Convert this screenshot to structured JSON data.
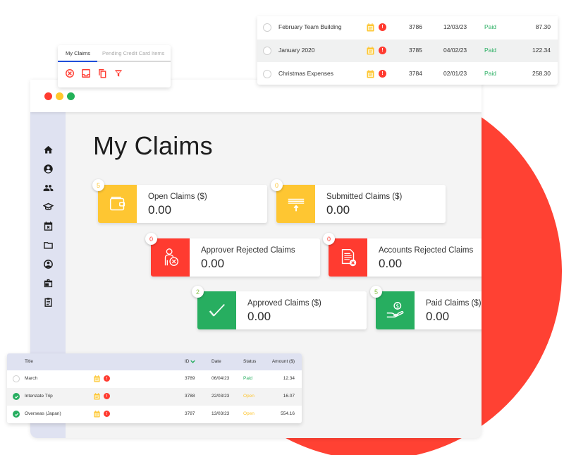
{
  "colors": {
    "accent_red": "#ff4133",
    "yellow": "#fec632",
    "green": "#27ae60",
    "tab_active": "#1f4fd9",
    "sidebar_bg": "#dfe2f1"
  },
  "window": {
    "title": "My Claims",
    "traffic_lights": [
      "close",
      "minimize",
      "maximize"
    ]
  },
  "sidebar": {
    "items": [
      {
        "icon": "home-icon"
      },
      {
        "icon": "account-icon"
      },
      {
        "icon": "people-icon"
      },
      {
        "icon": "graduation-cap-icon"
      },
      {
        "icon": "calendar-cancel-icon"
      },
      {
        "icon": "folder-icon"
      },
      {
        "icon": "support-icon"
      },
      {
        "icon": "briefcase-icon"
      },
      {
        "icon": "clipboard-icon"
      }
    ]
  },
  "tabs_panel": {
    "tabs": [
      {
        "label": "My Claims",
        "active": true
      },
      {
        "label": "Pending Credit Card Items",
        "active": false
      }
    ],
    "toolbar": [
      "cancel-icon",
      "inbox-icon",
      "copy-icon",
      "filter-icon"
    ]
  },
  "cards": [
    {
      "label": "Open Claims ($)",
      "value": "0.00",
      "count": "5",
      "color": "yellow",
      "icon": "wallet-icon"
    },
    {
      "label": "Submitted Claims ($)",
      "value": "0.00",
      "count": "0",
      "color": "yellow",
      "icon": "submit-icon"
    },
    {
      "label": "Approver Rejected Claims",
      "value": "0.00",
      "count": "0",
      "color": "red",
      "icon": "user-rejected-icon"
    },
    {
      "label": "Accounts Rejected Claims",
      "value": "0.00",
      "count": "0",
      "color": "red",
      "icon": "document-rejected-icon"
    },
    {
      "label": "Approved Claims ($)",
      "value": "0.00",
      "count": "2",
      "color": "green",
      "icon": "checkmark-icon"
    },
    {
      "label": "Paid Claims ($)",
      "value": "0.00",
      "count": "5",
      "color": "green",
      "icon": "hand-money-icon"
    }
  ],
  "top_table": {
    "rows": [
      {
        "title": "February Team Building",
        "id": "3786",
        "date": "12/03/23",
        "status": "Paid",
        "amount": "87.30",
        "selected": false
      },
      {
        "title": "January 2020",
        "id": "3785",
        "date": "04/02/23",
        "status": "Paid",
        "amount": "122.34",
        "selected": false
      },
      {
        "title": "Christmas Expenses",
        "id": "3784",
        "date": "02/01/23",
        "status": "Paid",
        "amount": "258.30",
        "selected": false
      }
    ]
  },
  "bottom_table": {
    "headers": {
      "title": "Title",
      "id": "ID",
      "date": "Date",
      "status": "Status",
      "amount": "Amount ($)"
    },
    "sort": {
      "column": "ID",
      "direction": "descending"
    },
    "rows": [
      {
        "title": "March",
        "id": "3789",
        "date": "06/04/23",
        "status": "Paid",
        "amount": "12.34",
        "selected": false
      },
      {
        "title": "Interstate Trip",
        "id": "3788",
        "date": "22/03/23",
        "status": "Open",
        "amount": "16.07",
        "selected": true
      },
      {
        "title": "Overseas (Japan)",
        "id": "3787",
        "date": "13/03/23",
        "status": "Open",
        "amount": "554.16",
        "selected": true
      }
    ]
  },
  "row_icons": {
    "note": "note-icon",
    "alert": "!"
  }
}
